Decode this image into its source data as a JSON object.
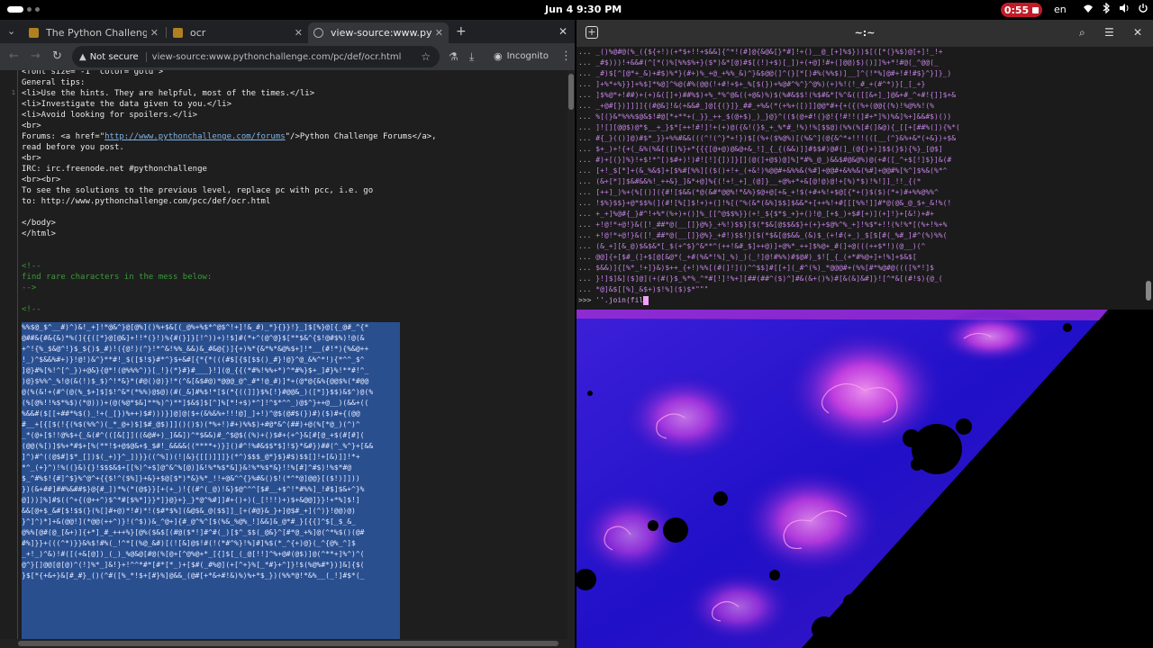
{
  "topbar": {
    "date": "Jun 4",
    "time": "9:30 PM",
    "recording_time": "0:55",
    "language": "en",
    "icons": [
      "wifi-icon",
      "bluetooth-icon",
      "volume-icon",
      "power-icon"
    ]
  },
  "browser": {
    "tabs": [
      {
        "title": "The Python Challenge",
        "active": false
      },
      {
        "title": "ocr",
        "active": false
      },
      {
        "title": "view-source:www.python",
        "active": true
      }
    ],
    "not_secure": "Not secure",
    "url": "view-source:www.pythonchallenge.com/pc/def/ocr.html",
    "incognito": "Incognito"
  },
  "source": {
    "lines": [
      {
        "text": "<font size=\"-1\" color=\"gold\">",
        "type": "code"
      },
      {
        "text": "General tips:",
        "type": "code"
      },
      {
        "text": "<li>Use the hints. They are helpful, most of the times.</li>",
        "type": "code"
      },
      {
        "text": "<li>Investigate the data given to you.</li>",
        "type": "code"
      },
      {
        "text": "<li>Avoid looking for spoilers.</li>",
        "type": "code"
      },
      {
        "text": "<br>",
        "type": "code"
      },
      {
        "text": "Forums: <a href=\"",
        "link": "http://www.pythonchallenge.com/forums",
        "after": "\"/>Python Challenge Forums</a>,",
        "type": "link"
      },
      {
        "text": "read before you post.",
        "type": "code"
      },
      {
        "text": "<br>",
        "type": "code"
      },
      {
        "text": "IRC: irc.freenode.net #pythonchallenge",
        "type": "code"
      },
      {
        "text": "<br><br>",
        "type": "code"
      },
      {
        "text": "To see the solutions to the previous level, replace pc with pcc, i.e. go",
        "type": "code"
      },
      {
        "text": "to: http://www.pythonchallenge.com/pcc/def/ocr.html",
        "type": "code"
      },
      {
        "text": "",
        "type": "code"
      },
      {
        "text": "</body>",
        "type": "code"
      },
      {
        "text": "</html>",
        "type": "code"
      },
      {
        "text": "",
        "type": "code"
      },
      {
        "text": "",
        "type": "code"
      },
      {
        "text": "<!--",
        "type": "comment"
      },
      {
        "text": "find rare characters in the mess below:",
        "type": "comment"
      },
      {
        "text": "-->",
        "type": "comment"
      },
      {
        "text": "",
        "type": "code"
      },
      {
        "text": "<!--",
        "type": "comment"
      }
    ],
    "mess": [
      "%%$@_$^__#)^)&!_+]!*@&^}@[@%]()%+$&[(_@%+%$*^@$^!+]!&_#)_*}{}}!}_]$[%}@[{_@#_^{*",
      "@##&{#&{&)*%(]{{([*}@[@&]+!!*(}!)%{#(}]}[!^))+)!$]#(*+^(@^@}$[**$&^{$!@#$%)!@(&",
      "+^!{%_$&@^!}$_${)$_#)!({@!)(^}!*^&!%%_&&)&_#&@{)]{+)%*{&*%*&@%$+]!*__(#!*){%&@++",
      "!_)^$&&%#+)}!@!)&^}**#!_$([$!$}#*^}$+&#[{*{*(((#$[{$[$$()_#}!@}^@_&%^*!){*^^_$^",
      "]@}#%[%!^[^_})+@&}{@*!(@%%%^)}[_!}(*}#}#___}!](@_{{(*#%!%%+*)^*#%}$+_]#}%!**#!^_",
      ")@}$%%^_%!@(&(!)$_$)^!*&}*(#@()@)}!*(^&[&$#@)*@@@_@^_#*!@_#)]*+(@*@{&%{@@$%(*#@@",
      "@(%(&!+(#^(@(%_$+]$]$!^&*(*%%)@$@)(#(_&]#%$!*[$(*{((]]}$%[!}#@@&_)([*]}$$)&$^)@(%",
      "(%[@%!!%$*%$)(*@)))+(@(%@*$&]**%)^)**]$&$]$[^]%[*!+$)*^]!^$*^^_)@$^}++@__)(&&+((",
      "%&&#($[[+##*%$()_!+(_[})%++)$#)))}]@]@($+(&%&%+!!!@]_]+!)^@$(@#$(})#)($)#+{(@@",
      "#__+[{[$(!{(%$(%%^)(_*_@+)$]$#_@$)]]()()$)(*%+!)#+)%%$)+#@*&^(##)+@(%[*@_)(^)^",
      "_*(@+[$!!@%$+{_&(#^(([&[]]((&@#+)_]&&])^*$&&)#_^$@$((%)+()$#+(+^}&[#[@_+$(#[#](",
      "(@@(%[)]$%+*#$+[%(**!$+@$@&+$_$#!_&&&&((****+)}]()#^!%#&$$*$]!$}*&#})##(^_%^}+[&&",
      "]^)#^((@$#]$*_[])$(_+)}^_])}}((^%])(!|&}{[[)]]]}(*^)$$$_@*}$}#$)$$[]!+[&)]]!*+",
      "*^_(+}^)!%((}&){}!$$$&$+[[%)^+$]@^&^%[@)]&!%*%$*&]}&!%*%$*&}!!%[#]^#$)!%$*#@",
      "$_^#%$!{#]^$}%^@^+{{$!^($%]}+&}+$@[$*)*&}%*_!!+@&^^{}%#&()$!(*^*@]@@}[($!)]]))",
      "})(&+##]##%&##$}@{#_])*%(*(@$}}[+(+_)!{(#^(_@)!&}$@^^^[$#__+$^!*#%%]_!#$]$&+^}%",
      "@]))]%]#$((^+{(@++^)$^*#[$%*]}}*]}@}+}_}*@^%#]]#+()+)(_[!!!)+)$+&@@]}}!+*%]$!]",
      "&&[@+$_&#[$!$$(}(%[]#+@)*!#)*!($#*$%](&@$&_@($$]]_[+(#@}&_}+]@$#_+](^)}!@@)@)",
      "}^]^)*]+&(@@!](*@@(++^)}!(^$))&_^@+]{#_@^%^[$(%&_%@%_!]&&]&_@*#_}[{{]^$[_$_&_",
      "@%%[@#(@_[&+)]{+*]_#_+++%}[@%($&$[(#@($*!]#^#(_)[$^_$$(_@&}^[#*@_+%]@(^*%$()(@#",
      "#%]}}+(((^*)}}&%$!#%(_!^*[(%@_&#)[(![&]@$!#(!(*#^%}!%]#]%$(*_^{+)@}(_^{@%_^]$",
      "_+!_)^&)!#([(+&[@])_(_)_%@&@[#@(%[@+[^@%@+*_[{]$[_(_@[!!]^%+@#(@$)]@(^**+]%^)^(",
      "@^}[]@@[@[@)^(!]%*_]&!}+!^^*#*[#*[*_)+[$#(_#%@](+[^+}%[_*#}+^]}!$(%@%#*})]&]{$(",
      "}$[*{+&+}&[#_#}_()(^#([%_*!$+[#}%]@&&_(@#[+*&+#!&)%)%+*$_})(%%*@!*&%__(_!]#$*(_"
    ]
  },
  "terminal": {
    "title": "~:~",
    "lines": [
      "_()%@#@(%_({${+!)(+*$+!!+$&&]{^*!(#]@{&@&[}*#]!+()__@_[+]%$}))$[([*(}%$)@[+]!_!+",
      "_#$)))!+&&#(^[*()%[%%$%+}($*)&*[@)#$[(!)+$)[_])+(+@]!#+(]@@)$)()]]%+*!#@(_^@@(_",
      "_#)$[^[@*+_&)+#$)%*}(#+)%_+@_+%%_&)^}&$@@(]^(}[*[)#%(%%$)]__]^(!*%]@#+!#!#$}^}]}_)",
      "]+%*+%}}]+%$]*%@]^%@(#%(@@(!+#!+$+_%[$(})+%@#^%^}^@%)(+)%!(!_#_+(#^*)}[_[_+}",
      "]$%@*+!##)+(+)&([]+)##%$)+%_*%^@&((+@&)%)$(%#&$$!(%$#&*[%^&(([[&+]_]@&+#_^+#!{]]$+&",
      "_+@#[})]]]]{(#@&]!&(+&&#_]@[{(}]}_##_+%&(*(+%+([)]]@@*#+{+({(%+(@@{(%)!%@%%!(%",
      "%[(}&*%%%$@&$!#@[*+**+(_}}_++_$(@+$)_)_}@}^(($(@+#!(}@!{!#!!(]#+*]%)%&]%+]&&#$)())",
      "]![][@@$)@*$__+_}$*[++!#!]!+(+)@({&!(}$_+_%*#_!%)!%[$$@)(%%(%[#(]&@){_[[+[##%(]){%*(",
      "#{_}(()]@)#$*_}}+%%#&&(((^!(^}*+!})$[(%+($%@%)[(%&^](@{&^*+!!!(([__(^}&%+&*(+&})+$&",
      "$+_)+!{+(_&%(%&[([)%}+*{{{[@+@)@&@+&_!]_{_{(&&)]]#$$#)@#(]_(@{)+)]$$(}$){%}_[@$]",
      "#)+[(}]%}!+$!*^[)$#+)!)#![!]{])]}[](@(]+@$)@]%]*#%_@_)&&$#@&@%)@(+#([_^+$[!]$}]&(#",
      "[+!_$[*]+(&_%&$]+[$%#[%%][($()+!+_(+&!)%@@#+&%%&(%#]+@@#+&%%&(%#]+@@#%[%^]$%&(%*^",
      "(&+[*]]$&#&&%!_++&}_]&*+@]%{(!+!_+]_(@]}__+@%+*+&[@!@)@!+[%)*$)!%!]]_!!_{(*",
      "[++]_)%+(%[()]({#![$&&(*@(&#*@@%!*&%}$@+@[+&_+!$(+#+%!+$@[{*+(}$($)(*+)#+%%@%%^",
      "!$%}$$}+@*$$%(](#![%[]$!+)+(]!%[(^%(&*(&%]$$]$&&*+[++%!+#[[[%%!]]#*@(@&_@_$+_&!%(!",
      "+_+]%@#{_}#^!+%*(%+)+()]%_[[^@$$%}}(+!_${$*$_+}+()!@_[+$_)+$#[+)](+]!}+[&!)+#+",
      "+!@!*+@!}&([!_##*@(__[]}@%}_+%!)$$}[$(*$&[@$$&$}+(+}+$@%^%_+]!%$*+!!(%!%*[(%+!%+%",
      "+!@!*+@!}&([!_##*@(__[]}@%}_+#!)$$!}[$(*$&[@$&&_(&)$_(+!#(+_)_$[$[#(_%#_]#^(%)%%(",
      "(&_+][&_@)$&$&*[_$(+^$}^&**^(++!&#_$]++@)]+@%*_++]$%@+_#(]+@(((++$*!)(@__)(^",
      "@@]{+[$#_(]+$[@[&@*(_+#(%&*!%]_%)_)(_!]@!#%%)#$@#)_$![_{_(+*#%@+]+!%]+$&$[",
      "$&&)]{[%*_!+]}&)$++_{+!)%%[(#(]!]()^^$$]#[[+](_#^(%)_*@@@#+(%%[#*%@#@((([%*!]$",
      "}!]$]&]($]@](+(#(}$_%*%_^*#[!]!%+][##(##^($)^]#&(&+()%)#[&(&]&#]}![^*&[(#!$){@_(",
      "*@]&$[[%]_&$+)$!%]($)$*\"\"\""
    ],
    "prompt": ">>> ",
    "command": "''.join(fil"
  }
}
